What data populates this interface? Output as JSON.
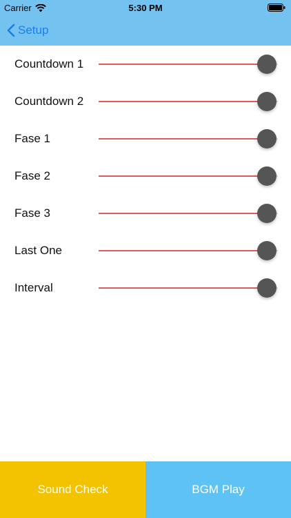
{
  "status_bar": {
    "carrier": "Carrier",
    "time": "5:30 PM",
    "icons": [
      "wifi-icon",
      "battery-icon"
    ]
  },
  "nav": {
    "back_label": "Setup",
    "back_icon": "chevron-left-icon"
  },
  "settings": [
    {
      "label": "Countdown 1",
      "value": 0.94
    },
    {
      "label": "Countdown 2",
      "value": 0.94
    },
    {
      "label": "Fase 1",
      "value": 0.94
    },
    {
      "label": "Fase 2",
      "value": 0.94
    },
    {
      "label": "Fase 3",
      "value": 0.94
    },
    {
      "label": "Last One",
      "value": 0.94
    },
    {
      "label": "Interval",
      "value": 0.94
    }
  ],
  "bottom": {
    "sound_check_label": "Sound Check",
    "bgm_play_label": "BGM Play"
  },
  "colors": {
    "bar_background": "#74c2f0",
    "back_link": "#1a7fe8",
    "slider_fill": "#e05a57",
    "slider_thumb": "#555555",
    "sound_check_bg": "#f3c200",
    "bgm_play_bg": "#5ec3f4"
  }
}
